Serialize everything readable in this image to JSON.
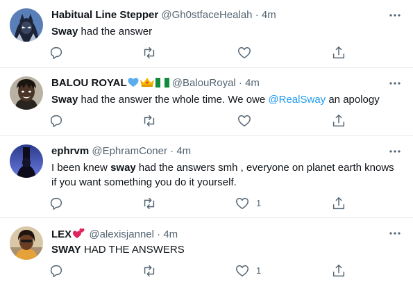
{
  "tweets": [
    {
      "name": "Habitual Line Stepper",
      "handle": "@Gh0stfaceHealah",
      "dot": "·",
      "time": "4m",
      "text_bold": "Sway",
      "text_rest": " had the answer",
      "like_count": ""
    },
    {
      "name": "BALOU ROYAL",
      "handle": "@BalouRoyal",
      "dot": "·",
      "time": "4m",
      "text_bold": "Sway",
      "text_rest": " had the answer the whole time. We owe ",
      "mention": "@RealSway",
      "text_end": " an apology",
      "like_count": ""
    },
    {
      "name": "ephrvm",
      "handle": "@EphramConer",
      "dot": "·",
      "time": "4m",
      "text_pre": "I been knew ",
      "text_bold": "sway",
      "text_rest": " had the answers smh , everyone on planet earth knows if you want something you do it yourself.",
      "like_count": "1"
    },
    {
      "name": "LEX",
      "handle": "@alexisjannel",
      "dot": "·",
      "time": "4m",
      "text_bold": "SWAY",
      "text_rest": " HAD THE ANSWERS",
      "like_count": "1"
    }
  ],
  "colors": {
    "text": "#0f1419",
    "secondary": "#536471",
    "link": "#1d9bf0",
    "divider": "#e6ecf0"
  },
  "icons": [
    "more-icon",
    "reply-icon",
    "retweet-icon",
    "like-icon",
    "share-icon"
  ]
}
